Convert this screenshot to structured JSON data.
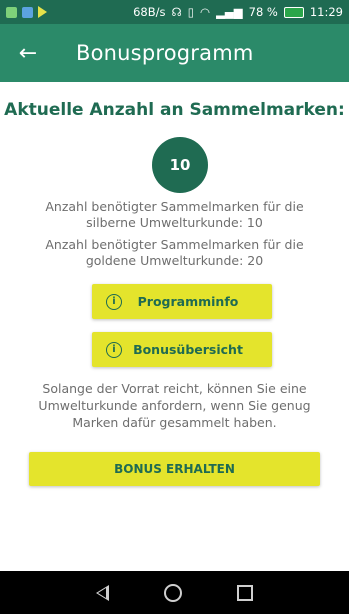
{
  "statusbar": {
    "speed": "68B/s",
    "battery": "78 %",
    "time": "11:29"
  },
  "appbar": {
    "back_icon": "←",
    "title": "Bonusprogramm"
  },
  "main": {
    "headline": "Aktuelle Anzahl an Sammelmarken:",
    "count": "10",
    "silver_requirement": "Anzahl benötigter Sammelmarken für die silberne Umwelturkunde: 10",
    "gold_requirement": "Anzahl benötigter Sammelmarken für die goldene Umwelturkunde: 20",
    "program_info_label": "Programminfo",
    "bonus_overview_label": "Bonusübersicht",
    "note": "Solange der Vorrat reicht, können Sie eine Umwelturkunde anfordern, wenn Sie genug Marken dafür gesammelt haben.",
    "bonus_button_label": "BONUS ERHALTEN",
    "info_glyph": "i"
  },
  "colors": {
    "primary": "#2b8a69",
    "primary_dark": "#1f6b52",
    "accent": "#e4e42c"
  }
}
